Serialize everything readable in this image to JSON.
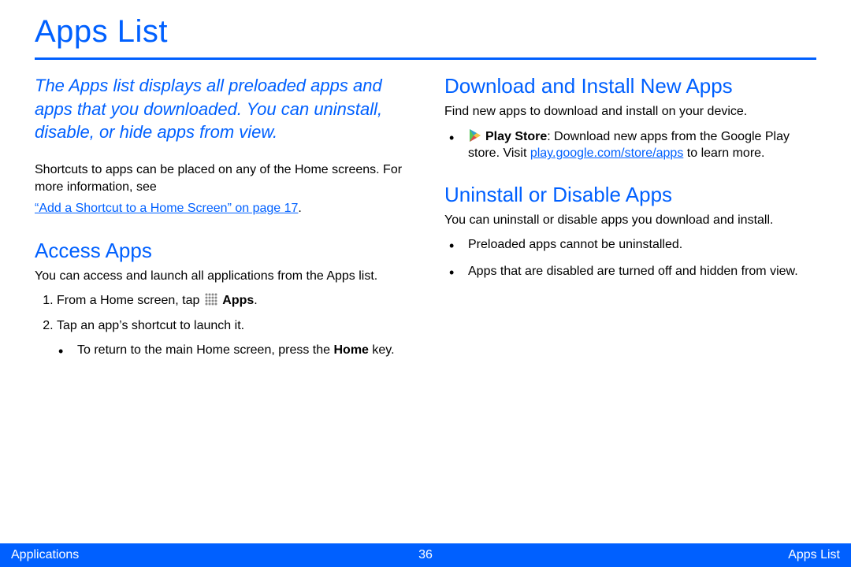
{
  "page_title": "Apps List",
  "intro": "The Apps list displays all preloaded apps and apps that you downloaded. You can uninstall, disable, or hide apps from view.",
  "shortcut_info_1": "Shortcuts to apps can be placed on any of the Home screens. For more information, see",
  "shortcut_xref": "“Add a Shortcut to a Home Screen” on page 17",
  "period": ".",
  "sections": {
    "access": {
      "heading": "Access Apps",
      "desc": "You can access and launch all applications from the Apps list.",
      "steps": {
        "s1_a": "From a Home screen, tap ",
        "s1_b": "Apps",
        "s1_c": ".",
        "s2": "Tap an app’s shortcut to launch it.",
        "s2_sub_a": "To return to the main Home screen, press the ",
        "s2_sub_b": "Home",
        "s2_sub_c": " key."
      }
    },
    "download": {
      "heading": "Download and Install New Apps",
      "desc": "Find new apps to download and install on your device.",
      "play_bold": "Play Store",
      "play_text_a": ": Download new apps from the Google Play store. Visit ",
      "play_link": "play.google.com/store/apps",
      "play_text_b": " to learn more."
    },
    "uninstall": {
      "heading": "Uninstall or Disable Apps",
      "desc": "You can uninstall or disable apps you download and install.",
      "b1": "Preloaded apps cannot be uninstalled.",
      "b2": "Apps that are disabled are turned off and hidden from view."
    }
  },
  "footer": {
    "left": "Applications",
    "center": "36",
    "right": "Apps List"
  }
}
